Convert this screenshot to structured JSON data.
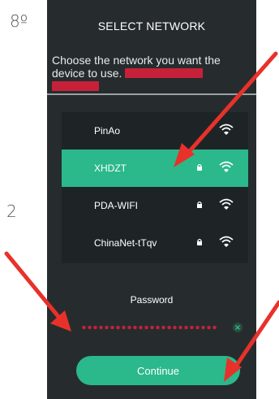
{
  "side_labels": {
    "top": "8º",
    "middle": "2"
  },
  "header": {
    "title": "SELECT NETWORK"
  },
  "instruction": {
    "text": "Choose the network you want the device to use."
  },
  "networks": [
    {
      "name": "PinAo",
      "locked": false,
      "selected": false
    },
    {
      "name": "XHDZT",
      "locked": true,
      "selected": true
    },
    {
      "name": "PDA-WIFI",
      "locked": true,
      "selected": false
    },
    {
      "name": "ChinaNet-tTqv",
      "locked": true,
      "selected": false
    }
  ],
  "password": {
    "label": "Password"
  },
  "continue_button": {
    "label": "Continue"
  },
  "colors": {
    "accent": "#2bb88a",
    "background": "#262c2e",
    "annotation_red": "#e8312a"
  },
  "icons": [
    "lock-icon",
    "wifi-icon",
    "clear-icon",
    "annotation-arrow"
  ]
}
